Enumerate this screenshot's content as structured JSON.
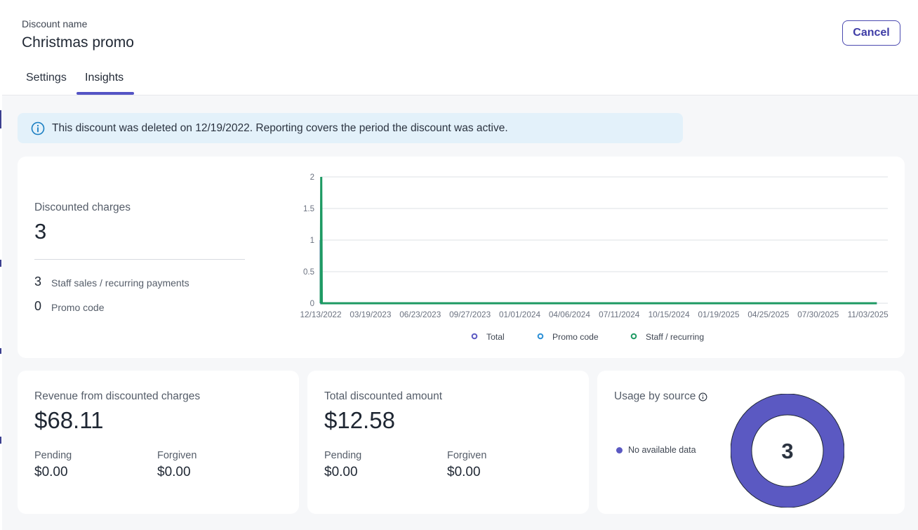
{
  "header": {
    "discount_label": "Discount name",
    "discount_name": "Christmas promo",
    "cancel_label": "Cancel",
    "tabs": [
      {
        "label": "Settings",
        "active": false
      },
      {
        "label": "Insights",
        "active": true
      }
    ]
  },
  "notice": {
    "icon": "info-icon",
    "text": "This discount was deleted on 12/19/2022. Reporting covers the period the discount was active."
  },
  "discounted_charges": {
    "label": "Discounted charges",
    "value": "3",
    "breakdown": [
      {
        "value": "3",
        "label": "Staff sales / recurring payments"
      },
      {
        "value": "0",
        "label": "Promo code"
      }
    ]
  },
  "chart_data": {
    "type": "line",
    "title": "",
    "xlabel": "",
    "ylabel": "",
    "ylim": [
      0,
      2
    ],
    "y_ticks": [
      "0",
      "0.5",
      "1",
      "1.5",
      "2"
    ],
    "x_tick_labels": [
      "12/13/2022",
      "03/19/2023",
      "06/23/2023",
      "09/27/2023",
      "01/01/2024",
      "04/06/2024",
      "07/11/2024",
      "10/15/2024",
      "01/19/2025",
      "04/25/2025",
      "07/30/2025",
      "11/03/2025"
    ],
    "grid": true,
    "legend_placement": "bottom",
    "series": [
      {
        "name": "Total",
        "color": "#5b59c2",
        "points": [
          [
            "12/13/2022",
            0
          ],
          [
            "12/13/2022",
            1
          ],
          [
            "12/14/2022",
            0
          ],
          [
            "11/20/2025",
            0
          ]
        ]
      },
      {
        "name": "Promo code",
        "color": "#2b8fd6",
        "points": [
          [
            "12/13/2022",
            0
          ],
          [
            "11/20/2025",
            0
          ]
        ]
      },
      {
        "name": "Staff / recurring",
        "color": "#1e9a63",
        "points": [
          [
            "12/13/2022",
            0
          ],
          [
            "12/14/2022",
            2
          ],
          [
            "12/15/2022",
            0
          ],
          [
            "11/20/2025",
            0
          ]
        ]
      }
    ]
  },
  "revenue": {
    "label": "Revenue from discounted charges",
    "value": "$68.11",
    "pending_label": "Pending",
    "pending_value": "$0.00",
    "forgiven_label": "Forgiven",
    "forgiven_value": "$0.00"
  },
  "total_discounted": {
    "label": "Total discounted amount",
    "value": "$12.58",
    "pending_label": "Pending",
    "pending_value": "$0.00",
    "forgiven_label": "Forgiven",
    "forgiven_value": "$0.00"
  },
  "usage": {
    "title": "Usage by source",
    "info_icon": "info-icon",
    "legend_label": "No available data",
    "legend_color": "#5b59c2",
    "center_value": "3",
    "ring_color": "#5b59c2"
  }
}
